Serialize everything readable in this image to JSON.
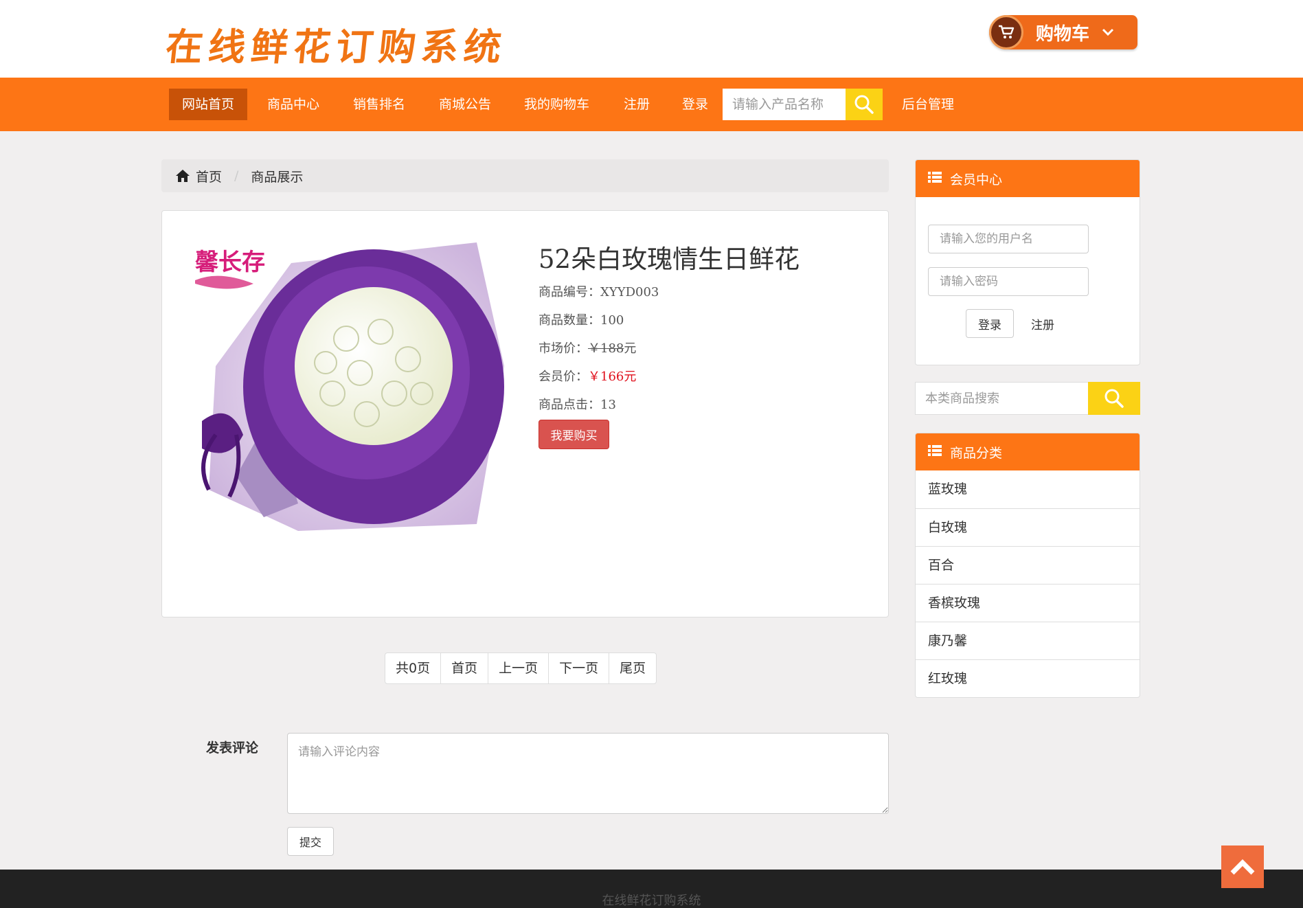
{
  "header": {
    "logo_text": "在线鲜花订购系统",
    "cart_label": "购物车"
  },
  "nav": {
    "items": [
      {
        "label": "网站首页",
        "active": true
      },
      {
        "label": "商品中心"
      },
      {
        "label": "销售排名"
      },
      {
        "label": "商城公告"
      },
      {
        "label": "我的购物车"
      },
      {
        "label": "注册"
      },
      {
        "label": "登录"
      }
    ],
    "search_placeholder": "请输入产品名称",
    "admin_label": "后台管理"
  },
  "breadcrumb": {
    "home": "首页",
    "current": "商品展示"
  },
  "product": {
    "title": "52朵白玫瑰情生日鲜花",
    "code_label": "商品编号：",
    "code": "XYYD003",
    "qty_label": "商品数量：",
    "qty": "100",
    "market_label": "市场价：",
    "market_price": "￥188",
    "market_unit": "元",
    "member_label": "会员价：",
    "member_price": "￥166元",
    "clicks_label": "商品点击：",
    "clicks": "13",
    "buy_label": "我要购买",
    "image_brand": "馨长存"
  },
  "pager": {
    "total": "共0页",
    "first": "首页",
    "prev": "上一页",
    "next": "下一页",
    "last": "尾页"
  },
  "comment": {
    "label": "发表评论",
    "placeholder": "请输入评论内容",
    "submit": "提交"
  },
  "member": {
    "title": "会员中心",
    "username_placeholder": "请输入您的用户名",
    "password_placeholder": "请输入密码",
    "login": "登录",
    "register": "注册"
  },
  "side_search": {
    "placeholder": "本类商品搜索"
  },
  "categories": {
    "title": "商品分类",
    "items": [
      "蓝玫瑰",
      "白玫瑰",
      "百合",
      "香槟玫瑰",
      "康乃馨",
      "红玫瑰"
    ]
  },
  "footer": {
    "text": "在线鲜花订购系统"
  },
  "colors": {
    "brand_orange": "#fd7515",
    "active_nav": "#c85208",
    "search_yellow": "#fbd215",
    "price_red": "#e0101c"
  }
}
